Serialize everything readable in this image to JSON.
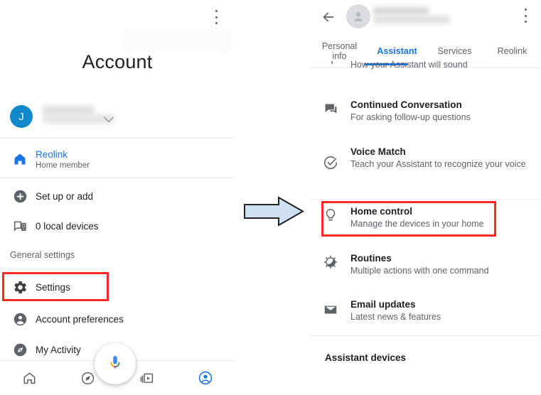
{
  "left_screen": {
    "title": "Account",
    "overflow_menu_icon": "more-vert-icon",
    "avatar_initial": "J",
    "account_name_blurred": "",
    "home_item": {
      "icon": "home-icon",
      "title": "Reolink",
      "subtitle": "Home member"
    },
    "rows": [
      {
        "icon": "plus-circle-icon",
        "title": "Set up or add"
      },
      {
        "icon": "local-device-icon",
        "title": "0 local devices"
      }
    ],
    "section_label": "General settings",
    "settings_rows": [
      {
        "icon": "gear-icon",
        "title": "Settings",
        "highlighted": true
      },
      {
        "icon": "person-circle-icon",
        "title": "Account preferences",
        "highlighted": false
      },
      {
        "icon": "compass-circle-icon",
        "title": "My Activity",
        "highlighted": false
      }
    ],
    "mic_fab_icon": "microphone-icon",
    "bottom_nav": [
      {
        "icon": "home-outline-icon",
        "active": false
      },
      {
        "icon": "explore-compass-icon",
        "active": false
      },
      {
        "icon": "media-library-icon",
        "active": false
      },
      {
        "icon": "account-circle-icon",
        "active": true
      }
    ]
  },
  "arrow": {
    "icon": "right-arrow-icon",
    "fill": "#cfe0f2",
    "stroke": "#222222"
  },
  "right_screen": {
    "back_icon": "back-arrow-icon",
    "avatar_icon": "person-avatar-icon",
    "account_name_blurred": "",
    "overflow_menu_icon": "more-vert-icon",
    "tabs": [
      {
        "label": "Personal\ninfo",
        "active": false
      },
      {
        "label": "Assistant",
        "active": true
      },
      {
        "label": "Services",
        "active": false
      },
      {
        "label": "Reolink",
        "active": false
      }
    ],
    "cut_off_item_subtitle": "How your Assistant will sound",
    "list": [
      {
        "icon": "chat-bubbles-icon",
        "title": "Continued Conversation",
        "subtitle": "For asking follow-up questions",
        "highlighted": false
      },
      {
        "icon": "check-circle-icon",
        "title": "Voice Match",
        "subtitle": "Teach your Assistant to recognize your voice",
        "highlighted": false
      },
      {
        "icon": "lightbulb-icon",
        "title": "Home control",
        "subtitle": "Manage the devices in your home",
        "highlighted": true
      },
      {
        "icon": "routines-icon",
        "title": "Routines",
        "subtitle": "Multiple actions with one command",
        "highlighted": false
      },
      {
        "icon": "envelope-icon",
        "title": "Email updates",
        "subtitle": "Latest news & features",
        "highlighted": false
      }
    ],
    "section_heading": "Assistant devices"
  },
  "colors": {
    "accent_blue": "#1a73e8",
    "avatar_blue": "#1289c9",
    "highlight_red": "#ff2a22",
    "icon_gray": "#5f6368",
    "divider": "#e8eaed"
  }
}
